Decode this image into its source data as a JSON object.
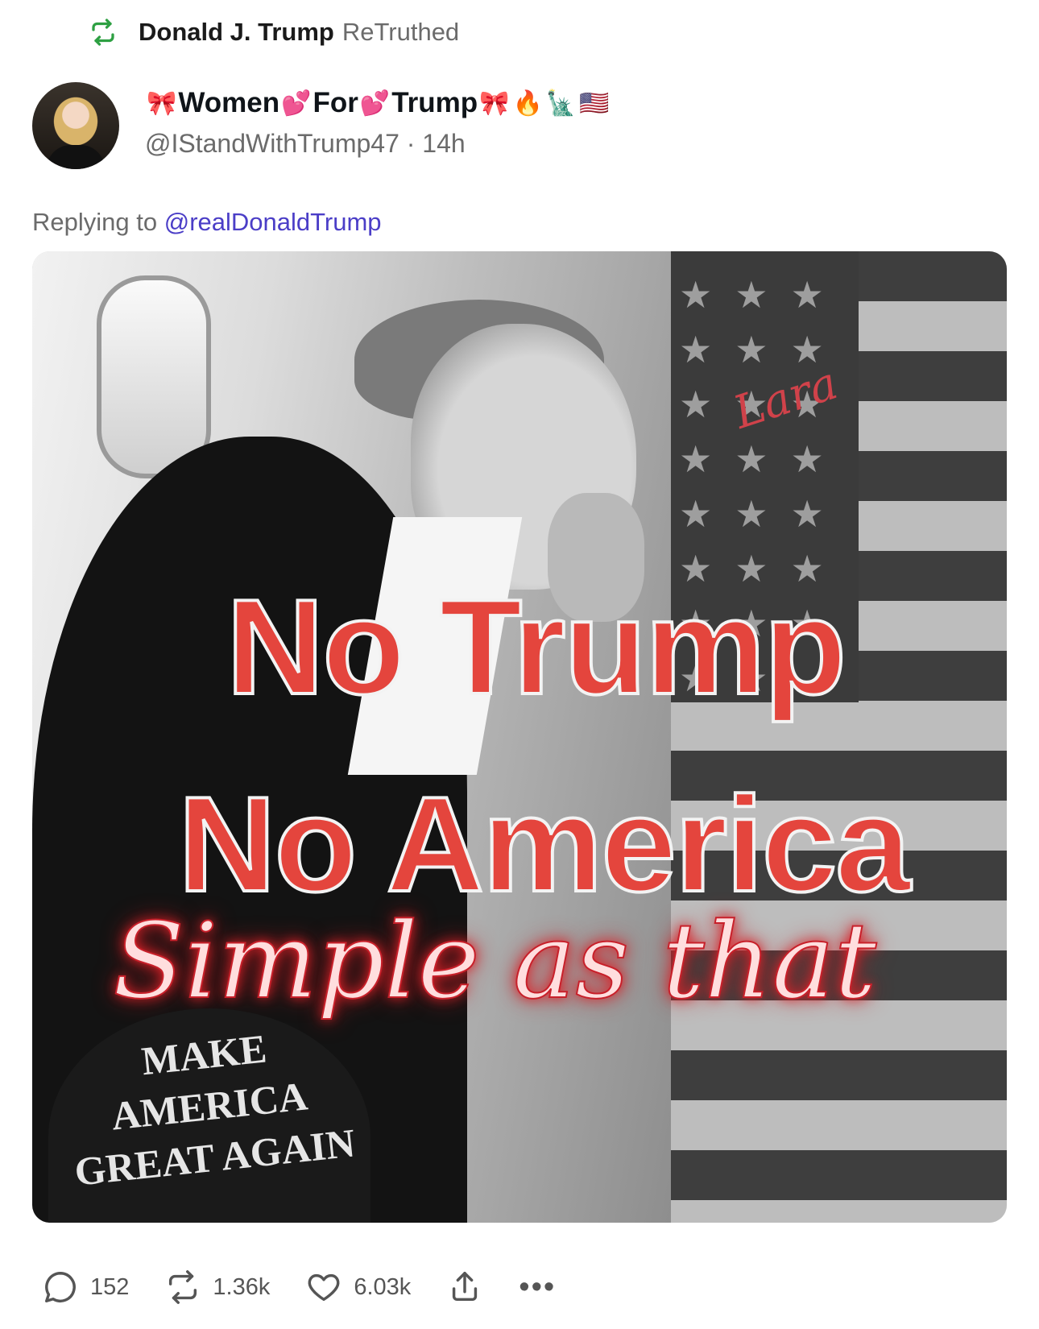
{
  "retruth": {
    "name": "Donald J. Trump",
    "verb": "ReTruthed"
  },
  "author": {
    "display_name_parts": [
      "Women",
      "For",
      "Trump"
    ],
    "handle": "@IStandWithTrump47",
    "time": "14h"
  },
  "reply": {
    "prefix": "Replying to",
    "mention": "@realDonaldTrump"
  },
  "media": {
    "line1": "No Trump",
    "line2": "No America",
    "line3": "Simple as that",
    "signature": "Lara",
    "cap_text": "MAKE AMERICA GREAT AGAIN"
  },
  "actions": {
    "replies": "152",
    "retruths": "1.36k",
    "likes": "6.03k",
    "more": "•••"
  },
  "colors": {
    "accent_green": "#2ea043",
    "mention": "#4b3ec7",
    "headline_red": "#e4453d"
  },
  "icons": [
    "retruth-icon",
    "reply-icon",
    "retruth-action-icon",
    "heart-icon",
    "share-icon",
    "more-icon"
  ]
}
